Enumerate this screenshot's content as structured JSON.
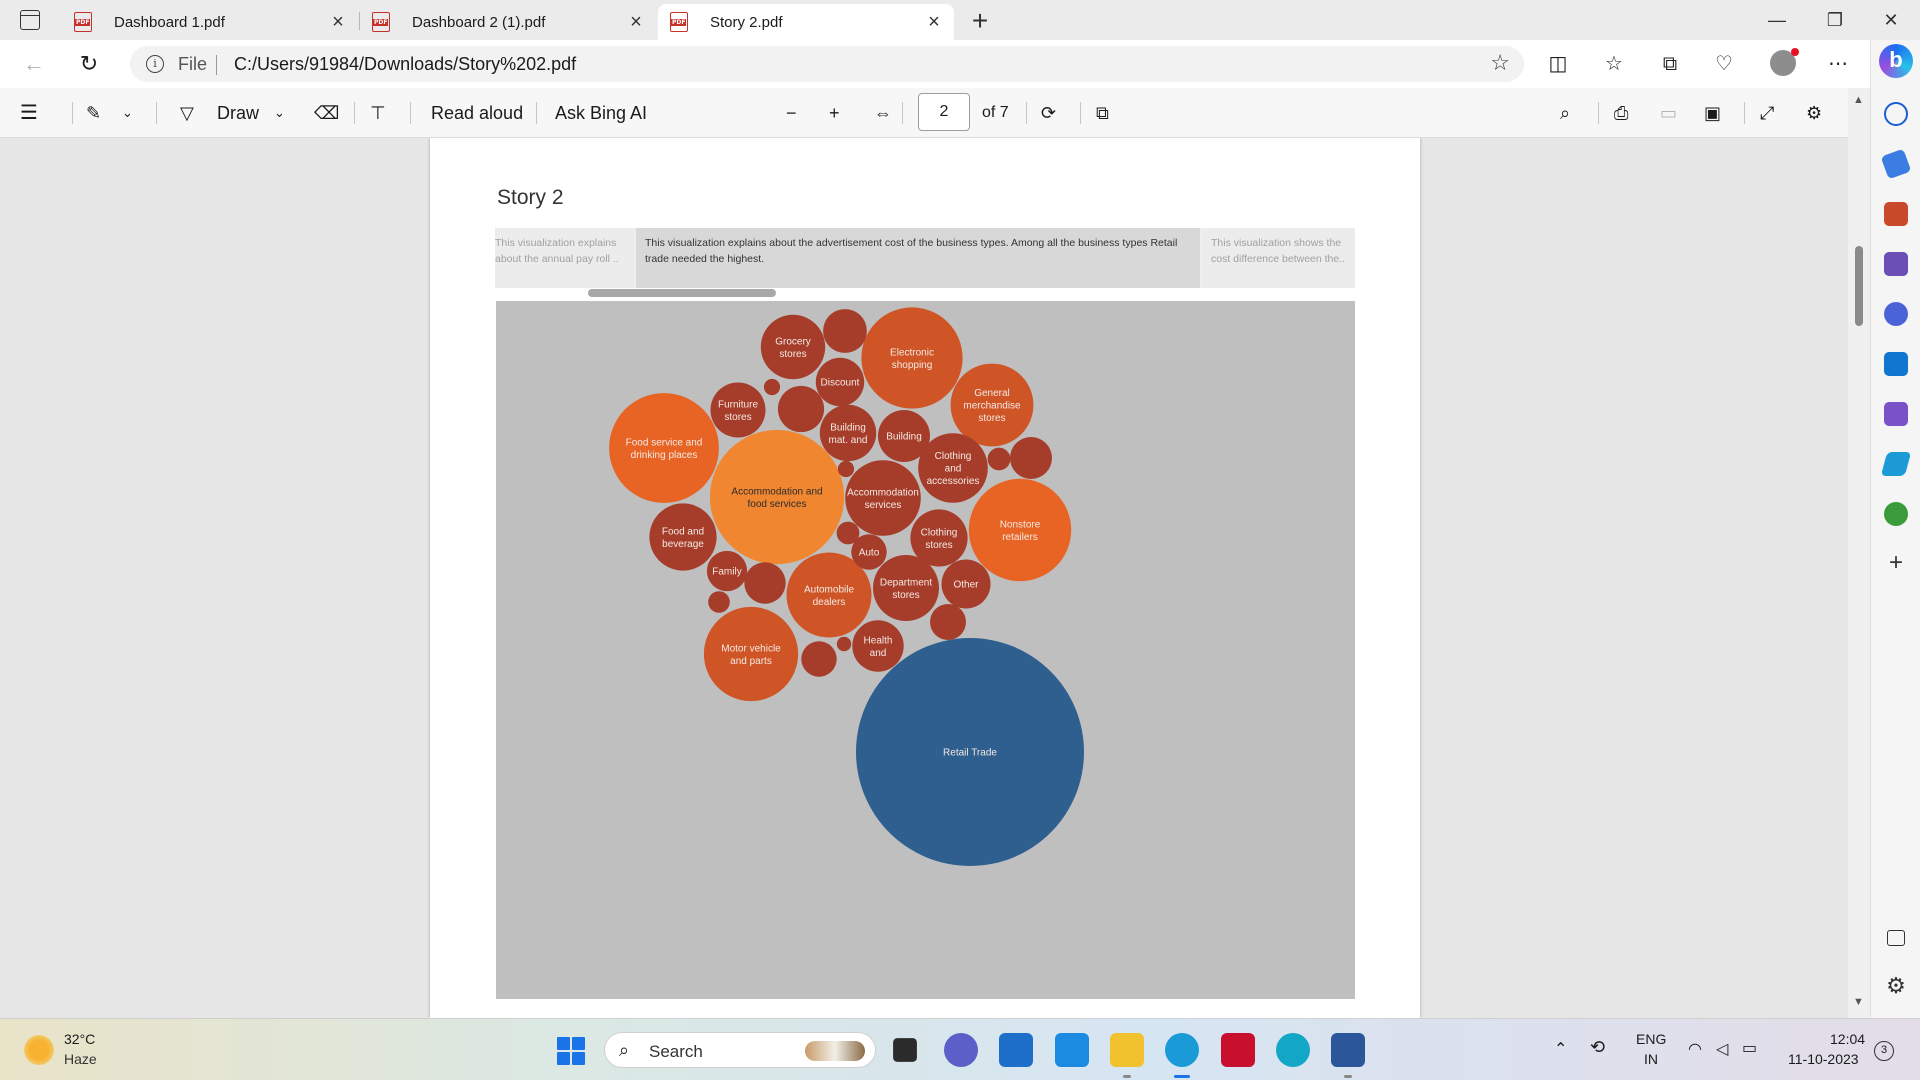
{
  "browser": {
    "tabs": [
      {
        "title": "Dashboard 1.pdf",
        "active": false
      },
      {
        "title": "Dashboard 2 (1).pdf",
        "active": false
      },
      {
        "title": "Story 2.pdf",
        "active": true
      }
    ],
    "address": {
      "scheme_label": "File",
      "url": "C:/Users/91984/Downloads/Story%202.pdf"
    }
  },
  "pdf_toolbar": {
    "draw_label": "Draw",
    "read_aloud_label": "Read aloud",
    "ask_bing_label": "Ask Bing AI",
    "page_current": "2",
    "page_total": "of 7"
  },
  "document": {
    "story_title": "Story 2",
    "story_points": [
      {
        "text": "This visualization explains about the annual pay roll ..",
        "current": false
      },
      {
        "text": "This visualization explains about the advertisement cost of the business types. Among all the business types Retail trade needed the highest.",
        "current": true
      },
      {
        "text": "This visualization shows the cost difference between the..",
        "current": false
      }
    ]
  },
  "chart_data": {
    "type": "bubble",
    "encoding": "circle area is proportional to advertisement cost; bubble values below are estimated relative sizes (Retail Trade = 100)",
    "colors": {
      "dark": "#a63d2a",
      "mid": "#cf5526",
      "bright": "#e86424",
      "highlight": "#f08730",
      "retail": "#2e5f8e"
    },
    "bubbles": [
      {
        "label": "Retail Trade",
        "value": 100,
        "color": "retail"
      },
      {
        "label": "Accommodation and food services",
        "value": 34.6,
        "color": "highlight"
      },
      {
        "label": "Food service and drinking places",
        "value": 23.2,
        "color": "bright"
      },
      {
        "label": "Nonstore retailers",
        "value": 20.2,
        "color": "bright"
      },
      {
        "label": "Electronic shopping",
        "value": 19.7,
        "color": "mid"
      },
      {
        "label": "Motor vehicle and parts",
        "value": 17.1,
        "color": "mid"
      },
      {
        "label": "General merchandise stores",
        "value": 13.2,
        "color": "mid"
      },
      {
        "label": "Automobile dealers",
        "value": 13.9,
        "color": "mid"
      },
      {
        "label": "Clothing and accessories",
        "value": 9.3,
        "color": "dark"
      },
      {
        "label": "Accommodation services",
        "value": 11.0,
        "color": "dark"
      },
      {
        "label": "Department stores",
        "value": 8.4,
        "color": "dark"
      },
      {
        "label": "Food and beverage",
        "value": 8.7,
        "color": "dark"
      },
      {
        "label": "Grocery stores",
        "value": 8.0,
        "color": "dark"
      },
      {
        "label": "Building mat. and",
        "value": 6.1,
        "color": "dark"
      },
      {
        "label": "Clothing stores",
        "value": 6.3,
        "color": "dark"
      },
      {
        "label": "Building",
        "value": 5.2,
        "color": "dark"
      },
      {
        "label": "Furniture stores",
        "value": 5.8,
        "color": "dark"
      },
      {
        "label": "Discount",
        "value": 4.5,
        "color": "dark"
      },
      {
        "label": "Other",
        "value": 4.6,
        "color": "dark"
      },
      {
        "label": "Health and",
        "value": 5.1,
        "color": "dark"
      },
      {
        "label": "Family",
        "value": 3.1,
        "color": "dark"
      },
      {
        "label": "Auto",
        "value": 2.4,
        "color": "dark"
      },
      {
        "label": "",
        "value": 3.7,
        "color": "dark"
      },
      {
        "label": "",
        "value": 4.1,
        "color": "dark"
      },
      {
        "label": "",
        "value": 3.3,
        "color": "dark"
      },
      {
        "label": "",
        "value": 3.4,
        "color": "dark"
      },
      {
        "label": "",
        "value": 2.4,
        "color": "dark"
      },
      {
        "label": "",
        "value": 0.5,
        "color": "dark"
      },
      {
        "label": "",
        "value": 0.5,
        "color": "dark"
      },
      {
        "label": "",
        "value": 1.0,
        "color": "dark"
      },
      {
        "label": "",
        "value": 1.0,
        "color": "dark"
      },
      {
        "label": "",
        "value": 0.9,
        "color": "dark"
      },
      {
        "label": "",
        "value": 0.4,
        "color": "dark"
      },
      {
        "label": "",
        "value": 2.5,
        "color": "dark"
      }
    ]
  },
  "taskbar": {
    "weather_temp": "32°C",
    "weather_desc": "Haze",
    "search_placeholder": "Search",
    "lang_top": "ENG",
    "lang_bottom": "IN",
    "time": "12:04",
    "date": "11-10-2023",
    "notifications": "3"
  }
}
